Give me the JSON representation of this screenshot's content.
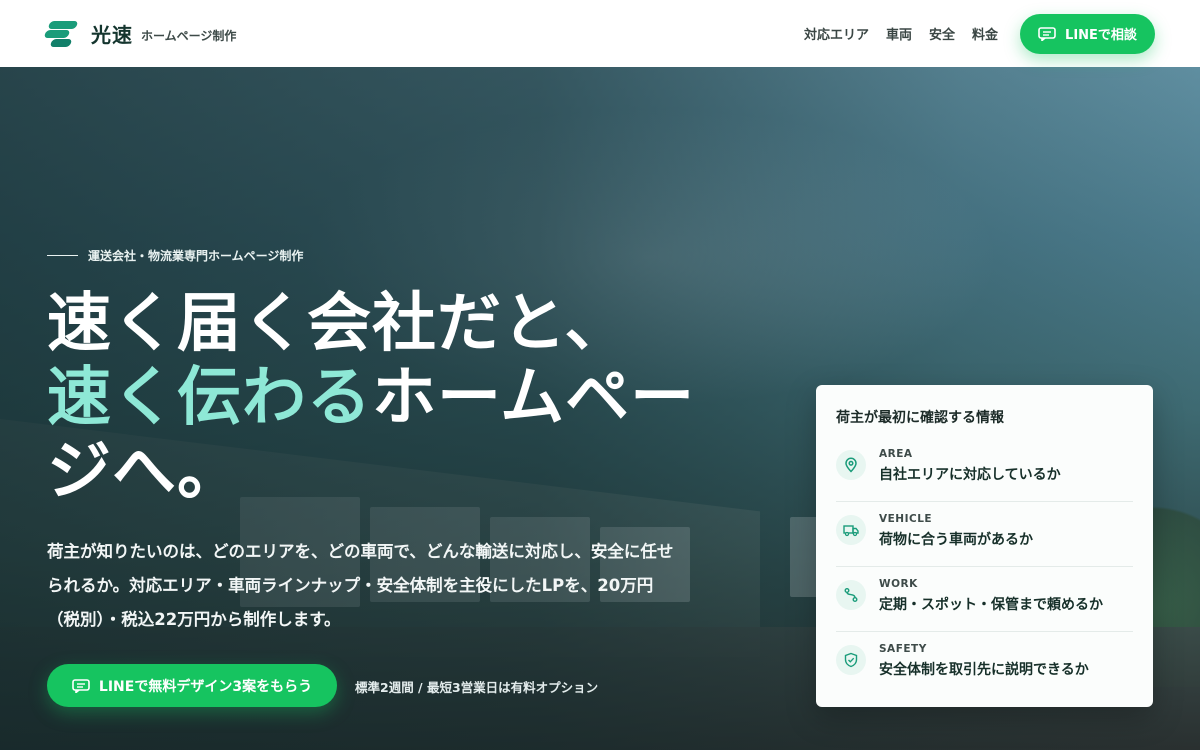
{
  "header": {
    "brand_name": "光速",
    "brand_sub": "ホームページ制作",
    "nav": [
      "対応エリア",
      "車両",
      "安全",
      "料金"
    ],
    "cta_label": "LINEで相談"
  },
  "hero": {
    "eyebrow": "運送会社・物流業専門ホームページ制作",
    "headline_line1": "速く届く会社だと、",
    "headline_accent": "速く伝わる",
    "headline_rest": "ホームペー",
    "headline_line3": "ジへ。",
    "lead_line1": "荷主が知りたいのは、どのエリアを、どの車両で、どんな輸送に対応し、安全に任せ",
    "lead_line2": "られるか。対応エリア・車両ラインナップ・安全体制を主役にしたLPを、20万円",
    "lead_line3": "（税別）・税込22万円から制作します。",
    "cta_label": "LINEで無料デザイン3案をもらう",
    "cta_note": "標準2週間 / 最短3営業日は有料オプション"
  },
  "card": {
    "title": "荷主が最初に確認する情報",
    "items": [
      {
        "label": "AREA",
        "text": "自社エリアに対応しているか",
        "icon": "map-pin-icon"
      },
      {
        "label": "VEHICLE",
        "text": "荷物に合う車両があるか",
        "icon": "truck-icon"
      },
      {
        "label": "WORK",
        "text": "定期・スポット・保管まで頼めるか",
        "icon": "route-icon"
      },
      {
        "label": "SAFETY",
        "text": "安全体制を取引先に説明できるか",
        "icon": "shield-check-icon"
      }
    ]
  },
  "colors": {
    "brand_green": "#1a9c7a",
    "line_green": "#16c460",
    "accent_mint": "#8ee8d6"
  }
}
